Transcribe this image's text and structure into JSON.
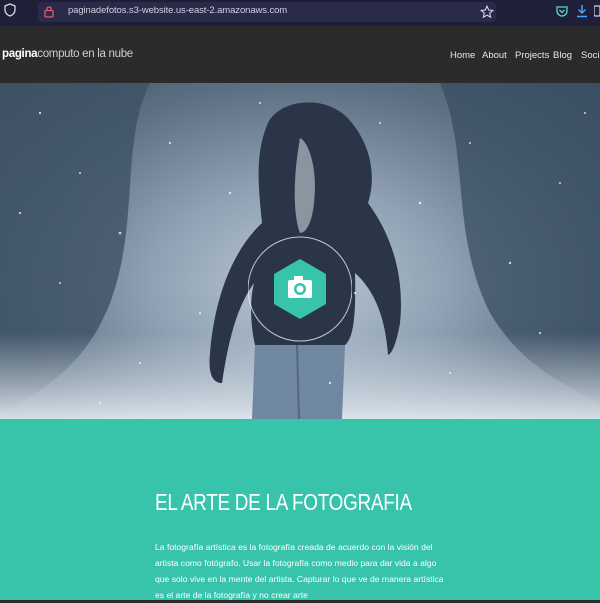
{
  "browser": {
    "url": "paginadefotos.s3-website.us-east-2.amazonaws.com",
    "icons": [
      "shield-icon",
      "lock-icon",
      "star-icon",
      "pocket-icon",
      "download-icon",
      "extension-icon"
    ]
  },
  "site": {
    "brand_bold": "pagina",
    "brand_rest": "computo en la nube",
    "nav": [
      "Home",
      "About",
      "Projects",
      "Blog",
      "Social"
    ]
  },
  "hero": {
    "emblem_icon": "camera-icon",
    "emblem_color": "#37c4ab"
  },
  "section": {
    "title": "EL ARTE DE LA FOTOGRAFIA",
    "body": "La fotografía artística es la fotografía creada de acuerdo con la visión del artista como fotógrafo. Usar la fotografía como medio para dar vida a algo que solo vive en la mente del artista. Capturar lo que ve de manera artística es el arte de la fotografía y no crear arte"
  },
  "colors": {
    "accent": "#37c4ab",
    "nav_bg": "#2b2b2b",
    "browser_bg": "#1f1f3a"
  }
}
